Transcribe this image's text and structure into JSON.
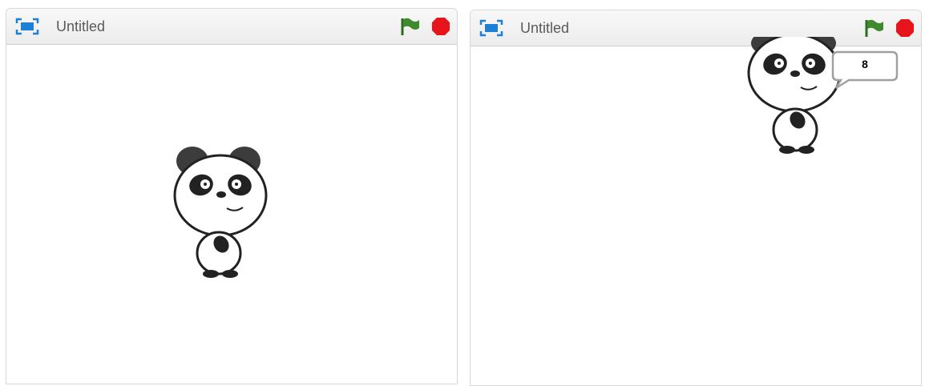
{
  "stages": [
    {
      "title": "Untitled",
      "speech_bubble": null
    },
    {
      "title": "Untitled",
      "speech_bubble": "8"
    }
  ],
  "icons": {
    "fullscreen": "fullscreen-icon",
    "green_flag": "green-flag-icon",
    "stop": "stop-icon"
  },
  "colors": {
    "fullscreen_blue": "#1d7fd6",
    "flag_green": "#3f8a2c",
    "stop_red": "#e8141b"
  }
}
